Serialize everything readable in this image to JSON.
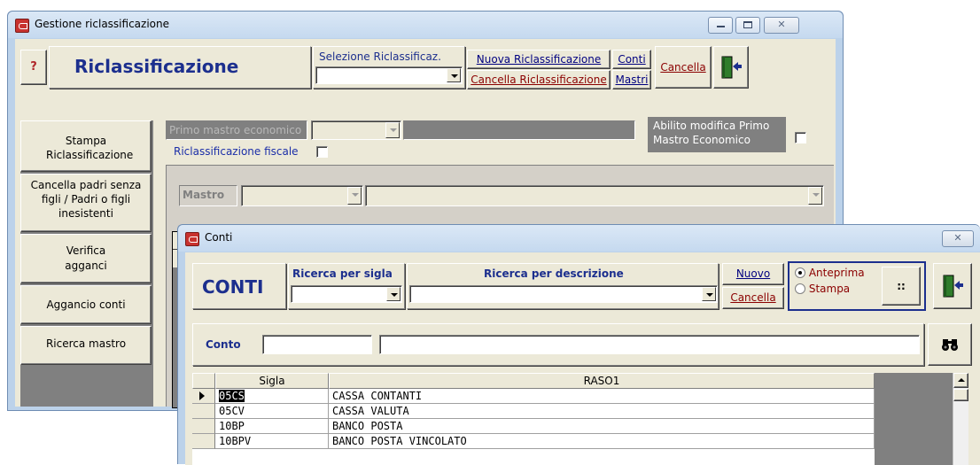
{
  "main_window": {
    "title": "Gestione riclassificazione",
    "help_label": "?",
    "header_title": "Riclassificazione",
    "selezione_label": "Selezione Riclassificaz.",
    "selezione_value": "",
    "nuova_label": "Nuova Riclassificazione",
    "cancella_riclass_label": "Cancella  Riclassificazione",
    "conti_label": "Conti",
    "mastri_label": "Mastri",
    "cancella_label": "Cancella",
    "sidebar": [
      {
        "label": "Stampa Riclassificazione"
      },
      {
        "label": "Cancella padri senza figli / Padri o figli inesistenti"
      },
      {
        "label": "Verifica agganci"
      },
      {
        "label": "Aggancio conti"
      },
      {
        "label": "Ricerca mastro"
      }
    ],
    "primo_mastro_placeholder": "Primo mastro economico",
    "riclass_fiscale_label": "Riclassificazione fiscale",
    "abilito_label": "Abilito modifica Primo Mastro Economico",
    "mastro_label": "Mastro"
  },
  "conti_window": {
    "title": "Conti",
    "header_title": "CONTI",
    "ricerca_sigla_label": "Ricerca per sigla",
    "ricerca_descrizione_label": "Ricerca per descrizione",
    "nuovo_label": "Nuovo",
    "cancella_label": "Cancella",
    "anteprima_label": "Anteprima",
    "stampa_label": "Stampa",
    "dots_label": "::",
    "conto_label": "Conto",
    "grid": {
      "columns": [
        "Sigla",
        "RASO1"
      ],
      "rows": [
        {
          "sigla": "05CS",
          "raso1": "CASSA CONTANTI",
          "selected": true
        },
        {
          "sigla": "05CV",
          "raso1": "CASSA VALUTA",
          "selected": false
        },
        {
          "sigla": "10BP",
          "raso1": "BANCO POSTA",
          "selected": false
        },
        {
          "sigla": "10BPV",
          "raso1": "BANCO POSTA VINCOLATO",
          "selected": false
        }
      ]
    }
  },
  "colors": {
    "title_red": "#b0262a",
    "header_blue": "#1c2f8e",
    "label_blue": "#1b2ea8",
    "disabled_gray": "#808080"
  }
}
